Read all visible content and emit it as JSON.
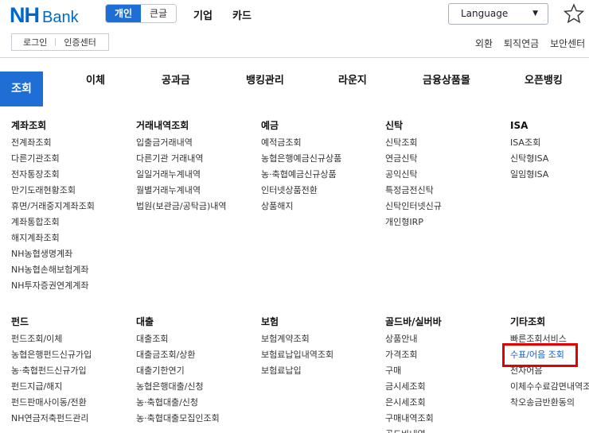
{
  "brand": {
    "nh": "NH",
    "bank": "Bank",
    "color": "#0069c8"
  },
  "segment": {
    "active": "개인",
    "inactive": "큰글"
  },
  "top_links": [
    "기업",
    "카드"
  ],
  "language": {
    "label": "Language",
    "caret": "▼"
  },
  "auth": {
    "login": "로그인",
    "cert": "인증센터"
  },
  "right_links": [
    "외환",
    "퇴직연금",
    "보안센터"
  ],
  "nav": {
    "active": "조회",
    "items": [
      "이체",
      "공과금",
      "뱅킹관리",
      "라운지",
      "금융상품몰",
      "오픈뱅킹"
    ]
  },
  "menu": [
    {
      "title": "계좌조회",
      "items": [
        "전계좌조회",
        "다른기관조회",
        "전자통장조회",
        "만기도래현황조회",
        "휴면/거래중지계좌조회",
        "계좌통합조회",
        "해지계좌조회",
        "NH농협생명계좌",
        "NH농협손해보험계좌",
        "NH투자증권연계계좌"
      ]
    },
    {
      "title": "거래내역조회",
      "items": [
        "입출금거래내역",
        "다른기관 거래내역",
        "일일거래누계내역",
        "월별거래누계내역",
        "법원(보관금/공탁금)내역"
      ]
    },
    {
      "title": "예금",
      "items": [
        "예적금조회",
        "농협은행예금신규상품",
        "농·축협예금신규상품",
        "인터넷상품전환",
        "상품해지"
      ]
    },
    {
      "title": "신탁",
      "items": [
        "신탁조회",
        "연금신탁",
        "공익신탁",
        "특정금전신탁",
        "신탁인터넷신규",
        "개인형IRP"
      ]
    },
    {
      "title": "ISA",
      "items": [
        "ISA조회",
        "신탁형ISA",
        "일임형ISA"
      ]
    },
    {
      "title": "펀드",
      "items": [
        "펀드조회/이체",
        "농협은행펀드신규가입",
        "농·축협펀드신규가입",
        "펀드지급/해지",
        "펀드판매사이동/전환",
        "NH연금저축펀드관리"
      ]
    },
    {
      "title": "대출",
      "items": [
        "대출조회",
        "대출금조회/상환",
        "대출기한연기",
        "농협은행대출/신청",
        "농·축협대출/신청",
        "농·축협대출모집인조회"
      ]
    },
    {
      "title": "보험",
      "items": [
        "보험계약조회",
        "보험료납입내역조회",
        "보험료납입"
      ]
    },
    {
      "title": "골드바/실버바",
      "items": [
        "상품안내",
        "가격조회",
        "구매",
        "금시세조회",
        "은시세조회",
        "구매내역조회",
        "골드바내역"
      ]
    },
    {
      "title": "기타조회",
      "items": [
        "빠른조회서비스",
        "수표/어음 조회",
        "전자어음",
        "이체수수료감면내역조회",
        "착오송금반환동의"
      ]
    }
  ],
  "highlight_item": "수표/어음 조회",
  "colors": {
    "accent": "#1e6ed6",
    "highlight_border": "#e50000"
  }
}
